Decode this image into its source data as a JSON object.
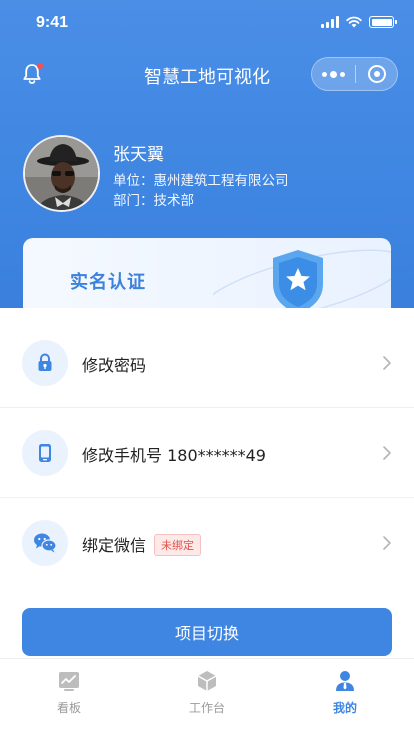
{
  "status_bar": {
    "time": "9:41"
  },
  "nav": {
    "title": "智慧工地可视化"
  },
  "user": {
    "name": "张天翼",
    "company_line": "单位：惠州建筑工程有限公司",
    "dept_line": "部门：技术部"
  },
  "verify_card": {
    "title": "实名认证"
  },
  "settings": [
    {
      "label": "修改密码",
      "icon": "lock-icon"
    },
    {
      "label": "修改手机号 180******49",
      "icon": "phone-icon"
    },
    {
      "label": "绑定微信",
      "icon": "wechat-icon",
      "tag": "未绑定"
    }
  ],
  "switch_button": {
    "label": "项目切换"
  },
  "tabbar": {
    "tabs": [
      {
        "label": "看板",
        "icon": "dashboard-icon",
        "active": false
      },
      {
        "label": "工作台",
        "icon": "workbench-icon",
        "active": false
      },
      {
        "label": "我的",
        "icon": "profile-icon",
        "active": true
      }
    ]
  },
  "colors": {
    "primary": "#3f86e2",
    "tag_red": "#e0524d",
    "icon_bg": "#eaf2fd"
  }
}
